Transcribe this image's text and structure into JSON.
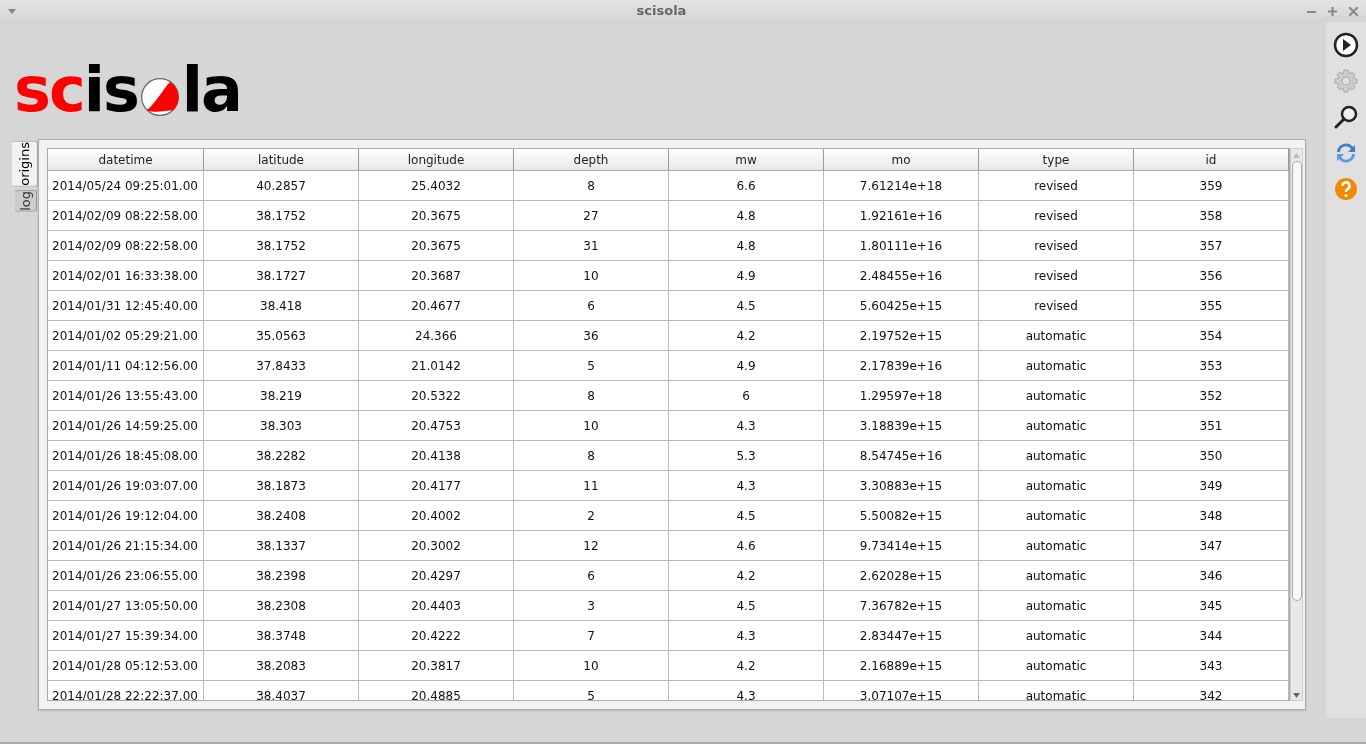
{
  "window": {
    "title": "scisola"
  },
  "logo": {
    "red_part": "sc",
    "black_part": "is",
    "end_part": "la"
  },
  "side_tabs": [
    {
      "label": "origins",
      "selected": true
    },
    {
      "label": "log",
      "selected": false
    }
  ],
  "table": {
    "columns": [
      "datetime",
      "latitude",
      "longitude",
      "depth",
      "mw",
      "mo",
      "type",
      "id"
    ],
    "rows": [
      [
        "2014/05/24 09:25:01.00",
        "40.2857",
        "25.4032",
        "8",
        "6.6",
        "7.61214e+18",
        "revised",
        "359"
      ],
      [
        "2014/02/09 08:22:58.00",
        "38.1752",
        "20.3675",
        "27",
        "4.8",
        "1.92161e+16",
        "revised",
        "358"
      ],
      [
        "2014/02/09 08:22:58.00",
        "38.1752",
        "20.3675",
        "31",
        "4.8",
        "1.80111e+16",
        "revised",
        "357"
      ],
      [
        "2014/02/01 16:33:38.00",
        "38.1727",
        "20.3687",
        "10",
        "4.9",
        "2.48455e+16",
        "revised",
        "356"
      ],
      [
        "2014/01/31 12:45:40.00",
        "38.418",
        "20.4677",
        "6",
        "4.5",
        "5.60425e+15",
        "revised",
        "355"
      ],
      [
        "2014/01/02 05:29:21.00",
        "35.0563",
        "24.366",
        "36",
        "4.2",
        "2.19752e+15",
        "automatic",
        "354"
      ],
      [
        "2014/01/11 04:12:56.00",
        "37.8433",
        "21.0142",
        "5",
        "4.9",
        "2.17839e+16",
        "automatic",
        "353"
      ],
      [
        "2014/01/26 13:55:43.00",
        "38.219",
        "20.5322",
        "8",
        "6",
        "1.29597e+18",
        "automatic",
        "352"
      ],
      [
        "2014/01/26 14:59:25.00",
        "38.303",
        "20.4753",
        "10",
        "4.3",
        "3.18839e+15",
        "automatic",
        "351"
      ],
      [
        "2014/01/26 18:45:08.00",
        "38.2282",
        "20.4138",
        "8",
        "5.3",
        "8.54745e+16",
        "automatic",
        "350"
      ],
      [
        "2014/01/26 19:03:07.00",
        "38.1873",
        "20.4177",
        "11",
        "4.3",
        "3.30883e+15",
        "automatic",
        "349"
      ],
      [
        "2014/01/26 19:12:04.00",
        "38.2408",
        "20.4002",
        "2",
        "4.5",
        "5.50082e+15",
        "automatic",
        "348"
      ],
      [
        "2014/01/26 21:15:34.00",
        "38.1337",
        "20.3002",
        "12",
        "4.6",
        "9.73414e+15",
        "automatic",
        "347"
      ],
      [
        "2014/01/26 23:06:55.00",
        "38.2398",
        "20.4297",
        "6",
        "4.2",
        "2.62028e+15",
        "automatic",
        "346"
      ],
      [
        "2014/01/27 13:05:50.00",
        "38.2308",
        "20.4403",
        "3",
        "4.5",
        "7.36782e+15",
        "automatic",
        "345"
      ],
      [
        "2014/01/27 15:39:34.00",
        "38.3748",
        "20.4222",
        "7",
        "4.3",
        "2.83447e+15",
        "automatic",
        "344"
      ],
      [
        "2014/01/28 05:12:53.00",
        "38.2083",
        "20.3817",
        "10",
        "4.2",
        "2.16889e+15",
        "automatic",
        "343"
      ],
      [
        "2014/01/28 22:22:37.00",
        "38.4037",
        "20.4885",
        "5",
        "4.3",
        "3.07107e+15",
        "automatic",
        "342"
      ]
    ]
  }
}
